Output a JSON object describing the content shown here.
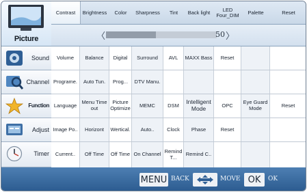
{
  "sidebar": {
    "picture": "Picture",
    "items": [
      "Sound",
      "Channel",
      "Function",
      "Adjust",
      "Timer"
    ]
  },
  "tabs": [
    "Contrast",
    "Brightness",
    "Color",
    "Sharpness",
    "Tint",
    "Back light",
    "LED Four_DIM",
    "Palette",
    "Reset"
  ],
  "slider": {
    "value": "50",
    "level": 0.45
  },
  "rows": {
    "sound": [
      "Volume",
      "Balance",
      "Digital",
      "Surround",
      "AVL",
      "MAXX Bass",
      "Reset",
      "",
      ""
    ],
    "channel": [
      "Programe.",
      "Auto Tun.",
      "Prog...",
      "DTV Manu.",
      "",
      "",
      "",
      "",
      ""
    ],
    "function": [
      "Language",
      "Menu Time out",
      "Picture Optimize",
      "MEMC",
      "DSM",
      "Intelligent Mode",
      "OPC",
      "Eye Guard Mode",
      "Reset"
    ],
    "adjust": [
      "Image Po..",
      "Horizont",
      "Wertical.",
      "Auto..",
      "Clock",
      "Phase",
      "Reset",
      "",
      ""
    ],
    "timer": [
      "Current..",
      "Off Time",
      "Off Time",
      "On Channel",
      "Remind T...",
      "Remind C..",
      "",
      "",
      ""
    ]
  },
  "bottom": {
    "menu": "MENU",
    "back": "BACK",
    "move": "MOVE",
    "ok": "OK",
    "ok_hint": "OK"
  }
}
